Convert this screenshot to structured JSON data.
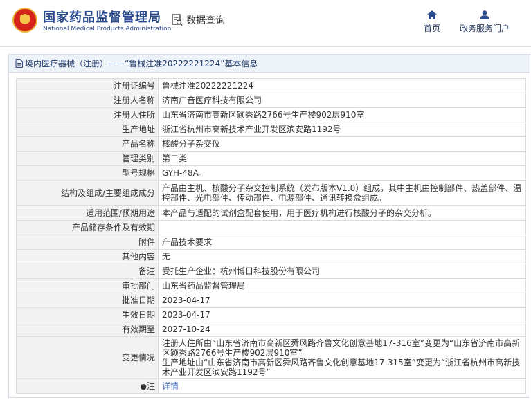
{
  "header": {
    "brand_cn": "国家药品监督管理局",
    "brand_en": "National Medical Products Administration",
    "data_query": "数据查询",
    "nav": [
      {
        "label": "首页",
        "icon": "home-icon"
      },
      {
        "label": "政务服务门户",
        "icon": "user-icon"
      }
    ]
  },
  "panel": {
    "title": "境内医疗器械（注册）——“鲁械注准20222221224”基本信息"
  },
  "rows": [
    {
      "key": "注册证编号",
      "value": "鲁械注准20222221224"
    },
    {
      "key": "注册人名称",
      "value": "济南广音医疗科技有限公司"
    },
    {
      "key": "注册人住所",
      "value": "山东省济南市高新区颖秀路2766号生产楼902层910室"
    },
    {
      "key": "生产地址",
      "value": "浙江省杭州市高新技术产业开发区滨安路1192号"
    },
    {
      "key": "产品名称",
      "value": "核酸分子杂交仪"
    },
    {
      "key": "管理类别",
      "value": "第二类"
    },
    {
      "key": "型号规格",
      "value": "GYH-48A。"
    },
    {
      "key": "结构及组成/主要组成成分",
      "value": "产品由主机、核酸分子杂交控制系统（发布版本V1.0）组成，其中主机由控制部件、热盖部件、温控部件、光电部件、传动部件、电源部件、通讯转换盒组成。"
    },
    {
      "key": "适用范围/预期用途",
      "value": "本产品与适配的试剂盒配套使用，用于医疗机构进行核酸分子的杂交分析。"
    },
    {
      "key": "产品储存条件及有效期",
      "value": ""
    },
    {
      "key": "附件",
      "value": "产品技术要求"
    },
    {
      "key": "其他内容",
      "value": "无"
    },
    {
      "key": "备注",
      "value": "受托生产企业：杭州博日科技股份有限公司"
    },
    {
      "key": "审批部门",
      "value": "山东省药品监督管理局"
    },
    {
      "key": "批准日期",
      "value": "2023-04-17"
    },
    {
      "key": "生效日期",
      "value": "2023-04-17"
    },
    {
      "key": "有效期至",
      "value": "2027-10-24"
    },
    {
      "key": "变更情况",
      "value": "注册人住所由“山东省济南市高新区舜风路齐鲁文化创意基地17-316室”变更为“山东省济南市高新区颖秀路2766号生产楼902层910室”\n生产地址由“山东省济南市高新区舜风路齐鲁文化创意基地17-315室”变更为“浙江省杭州市高新技术产业开发区滨安路1192号”"
    },
    {
      "key": "注",
      "value": "详情",
      "icon": "location-pin-icon"
    }
  ]
}
